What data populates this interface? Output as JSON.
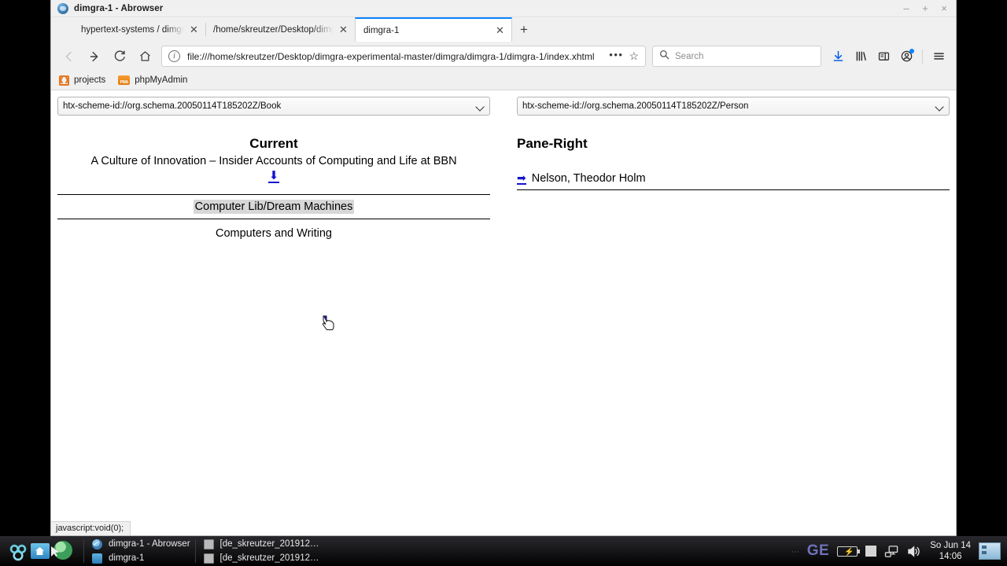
{
  "window": {
    "title": "dimgra-1 - Abrowser",
    "icon": "browser-globe-icon",
    "controls": {
      "minimize": "–",
      "maximize": "+",
      "close": "×"
    }
  },
  "tabs": [
    {
      "label": "hypertext-systems / dimgra-ex",
      "favicon": "firefox-icon",
      "close": "✕",
      "active": false
    },
    {
      "label": "/home/skreutzer/Desktop/dimgra-",
      "favicon": "none",
      "close": "✕",
      "active": false
    },
    {
      "label": "dimgra-1",
      "favicon": "none",
      "close": "✕",
      "active": true
    }
  ],
  "new_tab_label": "+",
  "navigation": {
    "back": "back-arrow",
    "forward": "forward-arrow",
    "reload": "reload-icon",
    "home": "home-icon",
    "url": "file:///home/skreutzer/Desktop/dimgra-experimental-master/dimgra/dimgra-1/dimgra-1/index.xhtml",
    "info_glyph": "i",
    "page_actions": "•••",
    "bookmark_star": "☆"
  },
  "search": {
    "placeholder": "Search",
    "icon": "search-icon"
  },
  "toolbar_icons": [
    {
      "name": "downloads-icon",
      "color": "#0a60df"
    },
    {
      "name": "library-icon",
      "color": "#2b2b2b"
    },
    {
      "name": "sidebar-icon",
      "color": "#2b2b2b"
    },
    {
      "name": "account-icon",
      "color": "#2b2b2b",
      "badge": "#0a84ff"
    },
    {
      "name": "menu-icon",
      "color": "#2b2b2b"
    }
  ],
  "bookmarks": [
    {
      "label": "projects",
      "icon": "projects-icon"
    },
    {
      "label": "phpMyAdmin",
      "icon": "phpmyadmin-icon"
    }
  ],
  "page": {
    "left_pane": {
      "scheme_select": {
        "value": "htx-scheme-id://org.schema.20050114T185202Z/Book",
        "options": [
          "htx-scheme-id://org.schema.20050114T185202Z/Book"
        ]
      },
      "heading": "Current",
      "entries": [
        {
          "text": "A Culture of Innovation – Insider Accounts of Computing and Life at BBN",
          "marker": "⬇",
          "marker_color": "#1414d0",
          "highlighted": false
        },
        {
          "text": "Computer Lib/Dream Machines",
          "marker": "",
          "marker_color": "",
          "highlighted": true
        },
        {
          "text": "Computers and Writing",
          "marker": "",
          "marker_color": "",
          "highlighted": false
        }
      ]
    },
    "right_pane": {
      "scheme_select": {
        "value": "htx-scheme-id://org.schema.20050114T185202Z/Person",
        "options": [
          "htx-scheme-id://org.schema.20050114T185202Z/Person"
        ]
      },
      "heading": "Pane-Right",
      "entries": [
        {
          "text": "Nelson, Theodor Holm",
          "marker": "➡",
          "marker_color": "#1414d0"
        }
      ]
    }
  },
  "status_text": "javascript:void(0);",
  "cursor": {
    "type": "pointing-hand-cursor"
  },
  "taskbar": {
    "launchers": [
      {
        "name": "swirl-launcher-icon"
      },
      {
        "name": "file-manager-icon"
      },
      {
        "name": "web-browser-icon"
      }
    ],
    "tasks_col1": [
      {
        "label": "dimgra-1 - Abrowser",
        "icon": "browser-window-icon"
      },
      {
        "label": "dimgra-1",
        "icon": "folder-window-icon"
      }
    ],
    "tasks_col2": [
      {
        "label": "[de_skreutzer_201912…",
        "icon": "window-icon"
      },
      {
        "label": "[de_skreutzer_201912…",
        "icon": "window-icon"
      }
    ],
    "tray": {
      "keyboard_layout": "GE",
      "battery": "battery-icon",
      "unknown": "square-icon",
      "network": "network-icon",
      "volume": "volume-icon",
      "clock_date": "So Jun 14",
      "clock_time": "14:06",
      "show_desktop": "show-desktop-icon"
    }
  }
}
